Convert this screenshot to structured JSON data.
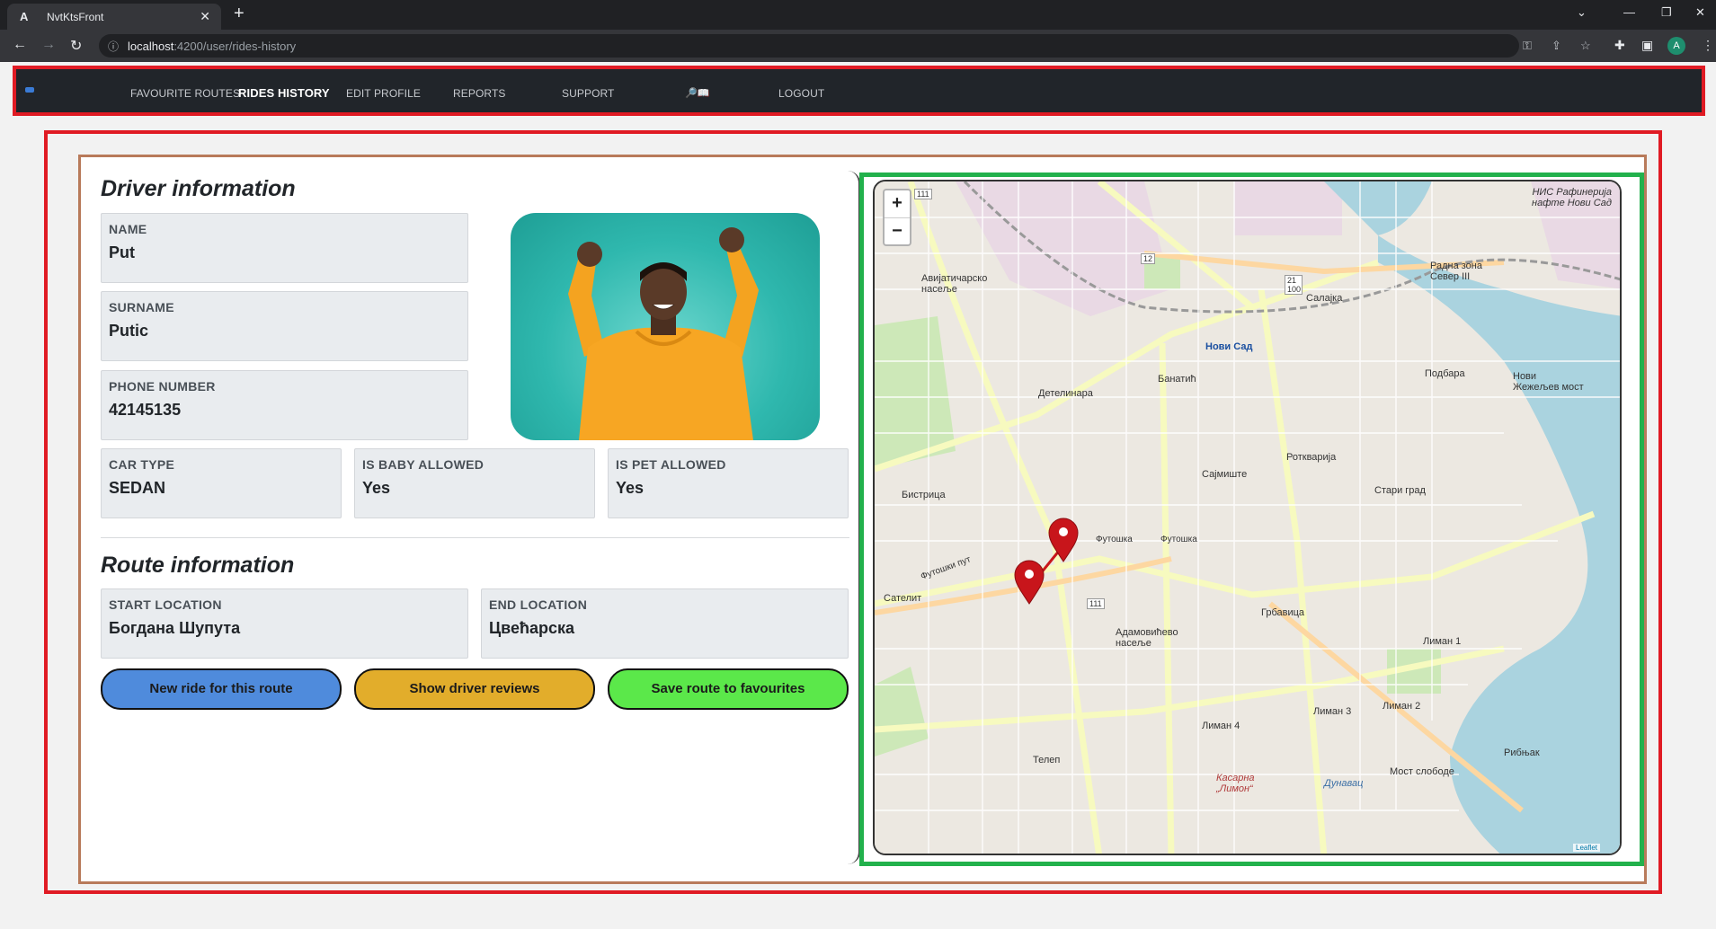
{
  "browser": {
    "tab_title": "NvtKtsFront",
    "tab_favicon": "A",
    "url_host": "localhost",
    "url_path": ":4200/user/rides-history",
    "profile_initial": "A"
  },
  "nav": {
    "items": [
      {
        "label": "FAVOURITE ROUTES",
        "active": false
      },
      {
        "label": "RIDES HISTORY",
        "active": true
      },
      {
        "label": "EDIT PROFILE",
        "active": false
      },
      {
        "label": "REPORTS",
        "active": false
      },
      {
        "label": "SUPPORT",
        "active": false
      },
      {
        "label": "LOGOUT",
        "active": false
      }
    ],
    "search_icons": "🔎📖"
  },
  "driver": {
    "heading": "Driver information",
    "name_label": "NAME",
    "name": "Put",
    "surname_label": "SURNAME",
    "surname": "Putic",
    "phone_label": "PHONE NUMBER",
    "phone": "42145135",
    "car_type_label": "CAR TYPE",
    "car_type": "SEDAN",
    "baby_label": "IS BABY ALLOWED",
    "baby": "Yes",
    "pet_label": "IS PET ALLOWED",
    "pet": "Yes"
  },
  "route": {
    "heading": "Route information",
    "start_label": "START LOCATION",
    "start": "Богдана Шупута",
    "end_label": "END LOCATION",
    "end": "Цвећарска"
  },
  "buttons": {
    "new_ride": "New ride for this route",
    "reviews": "Show driver reviews",
    "save": "Save route to favourites",
    "new_ride_color": "#4f8bdc",
    "reviews_color": "#e2ad2b",
    "save_color": "#5be84a"
  },
  "map": {
    "zoom_in": "+",
    "zoom_out": "−",
    "attribution": "Leaflet",
    "labels": {
      "novi_sad": "Нови Сад",
      "detelinara": "Детелинара",
      "banatic": "Банатић",
      "salajka": "Салајка",
      "podbara": "Подбара",
      "rotkvarija": "Ротква­рија",
      "sajmiste": "Сајмиште",
      "stari_grad": "Стари град",
      "bistrica": "Бистрица",
      "satelit": "Сателит",
      "grbavica": "Грбавица",
      "adamovicevo": "Адамовићево насеље",
      "telep": "Телеп",
      "liman1": "Лиман 1",
      "liman2": "Лиман 2",
      "liman3": "Лиман 3",
      "liman4": "Лиман 4",
      "most_slobode": "Мост слободе",
      "ribnjak": "Рибњак",
      "kasarna": "Касарна „Лимон“",
      "dunavac": "Дунавац",
      "avijaticarsko": "Авијатичарско насеље",
      "nis": "НИС Рафинерија нафте Нови Сад",
      "radna_zona": "Радна зона Север III",
      "novi_zezeljev": "Нови Жежељев мост",
      "futoska": "Футошка",
      "futoska2": "Футошка",
      "futoski_put": "Футошки пут",
      "road12": "12",
      "road21": "21 100",
      "road111a": "111",
      "road111b": "111"
    }
  }
}
